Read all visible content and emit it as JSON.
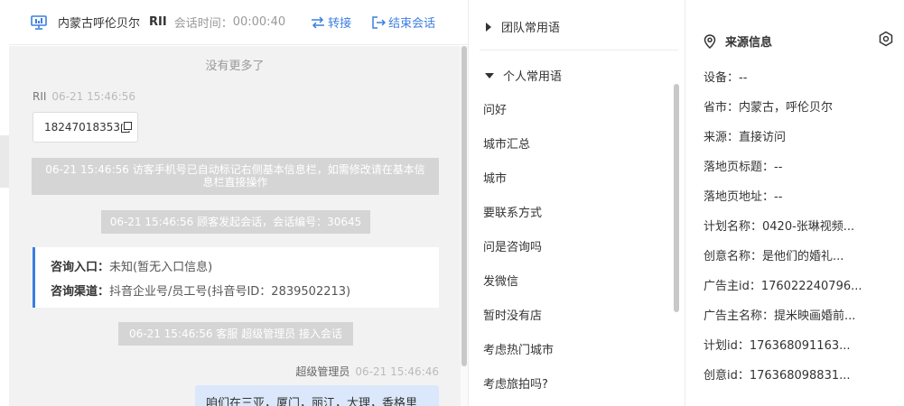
{
  "chat": {
    "header": {
      "location": "内蒙古呼伦贝尔",
      "user": "RII",
      "time_label": "会话时间：",
      "time": "00:00:40",
      "transfer": "转接",
      "end": "结束会话"
    },
    "no_more": "没有更多了",
    "visitor_msg": {
      "sender": "RII",
      "time": "06-21 15:46:56",
      "phone": "18247018353"
    },
    "system1": "06-21 15:46:56 访客手机号已自动标记右侧基本信息栏，如需修改请在基本信息栏直接操作",
    "system2": "06-21 15:46:56 顾客发起会话，会话编号：30645",
    "info_card": {
      "entry_label": "咨询入口：",
      "entry_value": "未知(暂无入口信息)",
      "channel_label": "咨询渠道：",
      "channel_value": "抖音企业号/员工号(抖音号ID：2839502213)"
    },
    "system3": "06-21 15:46:56 客服 超级管理员 接入会话",
    "agent_msg": {
      "sender": "超级管理员",
      "time": "06-21 15:46:46",
      "text": "咱们在三亚，厦门，丽江，大理，香格里"
    }
  },
  "phrases": {
    "team_group": "团队常用语",
    "personal_group": "个人常用语",
    "items": [
      "问好",
      "城市汇总",
      "城市",
      "要联系方式",
      "问是咨询吗",
      "发微信",
      "暂时没有店",
      "考虑热门城市",
      "考虑旅拍吗?"
    ]
  },
  "source": {
    "title": "来源信息",
    "rows": [
      "设备：--",
      "省市：内蒙古，呼伦贝尔",
      "来源：直接访问",
      "落地页标题：--",
      "落地页地址：--",
      "计划名称：0420-张琳视频...",
      "创意名称：是他们的婚礼...",
      "广告主id：176022240796...",
      "广告主名称：提米映画婚前...",
      "计划id：176368091163...",
      "创意id：176368098831..."
    ]
  },
  "colors": {
    "accent": "#3b7fe0",
    "system_msg_bg": "#d5d5d5",
    "agent_bubble_bg": "#dbe8fb"
  }
}
